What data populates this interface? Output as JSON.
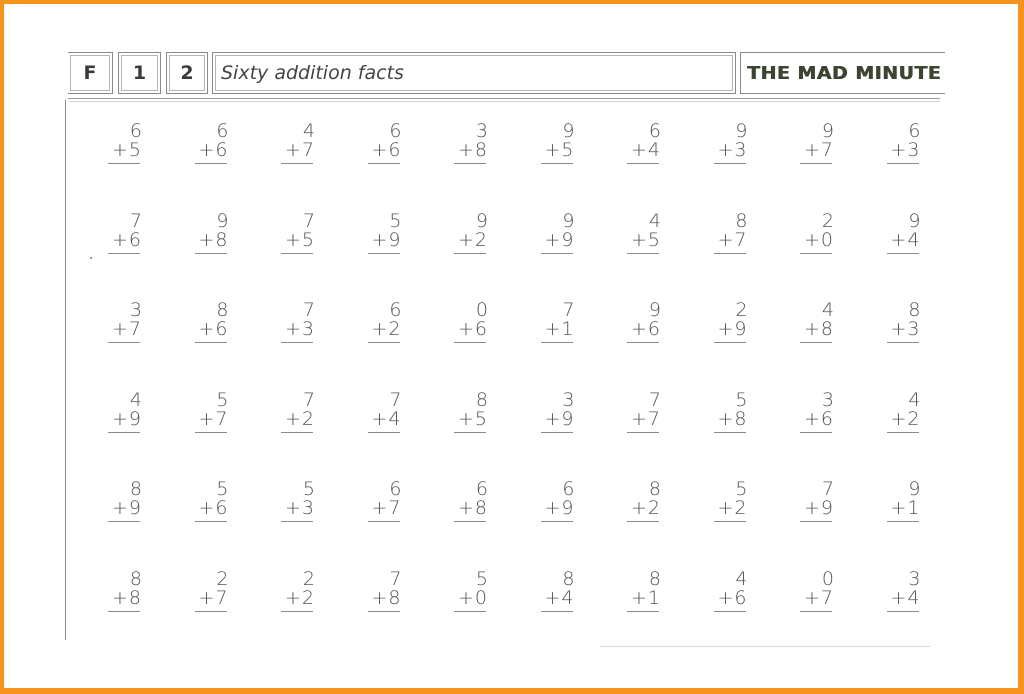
{
  "header": {
    "code_letter": "F",
    "code_num1": "1",
    "code_num2": "2",
    "title": "Sixty addition facts",
    "brand": "THE MAD MINUTE"
  },
  "colors": {
    "frame": "#f7941d",
    "paper": "#ffffff",
    "ink": "#555555"
  },
  "problems": [
    [
      [
        "6",
        "5"
      ],
      [
        "6",
        "6"
      ],
      [
        "4",
        "7"
      ],
      [
        "6",
        "6"
      ],
      [
        "3",
        "8"
      ],
      [
        "9",
        "5"
      ],
      [
        "6",
        "4"
      ],
      [
        "9",
        "3"
      ],
      [
        "9",
        "7"
      ],
      [
        "6",
        "3"
      ]
    ],
    [
      [
        "7",
        "6"
      ],
      [
        "9",
        "8"
      ],
      [
        "7",
        "5"
      ],
      [
        "5",
        "9"
      ],
      [
        "9",
        "2"
      ],
      [
        "9",
        "9"
      ],
      [
        "4",
        "5"
      ],
      [
        "8",
        "7"
      ],
      [
        "2",
        "0"
      ],
      [
        "9",
        "4"
      ]
    ],
    [
      [
        "3",
        "7"
      ],
      [
        "8",
        "6"
      ],
      [
        "7",
        "3"
      ],
      [
        "6",
        "2"
      ],
      [
        "0",
        "6"
      ],
      [
        "7",
        "1"
      ],
      [
        "9",
        "6"
      ],
      [
        "2",
        "9"
      ],
      [
        "4",
        "8"
      ],
      [
        "8",
        "3"
      ]
    ],
    [
      [
        "4",
        "9"
      ],
      [
        "5",
        "7"
      ],
      [
        "7",
        "2"
      ],
      [
        "7",
        "4"
      ],
      [
        "8",
        "5"
      ],
      [
        "3",
        "9"
      ],
      [
        "7",
        "7"
      ],
      [
        "5",
        "8"
      ],
      [
        "3",
        "6"
      ],
      [
        "4",
        "2"
      ]
    ],
    [
      [
        "8",
        "9"
      ],
      [
        "5",
        "6"
      ],
      [
        "5",
        "3"
      ],
      [
        "6",
        "7"
      ],
      [
        "6",
        "8"
      ],
      [
        "6",
        "9"
      ],
      [
        "8",
        "2"
      ],
      [
        "5",
        "2"
      ],
      [
        "7",
        "9"
      ],
      [
        "9",
        "1"
      ]
    ],
    [
      [
        "8",
        "8"
      ],
      [
        "2",
        "7"
      ],
      [
        "2",
        "2"
      ],
      [
        "7",
        "8"
      ],
      [
        "5",
        "0"
      ],
      [
        "8",
        "4"
      ],
      [
        "8",
        "1"
      ],
      [
        "4",
        "6"
      ],
      [
        "0",
        "7"
      ],
      [
        "3",
        "4"
      ]
    ]
  ],
  "operator": "+"
}
